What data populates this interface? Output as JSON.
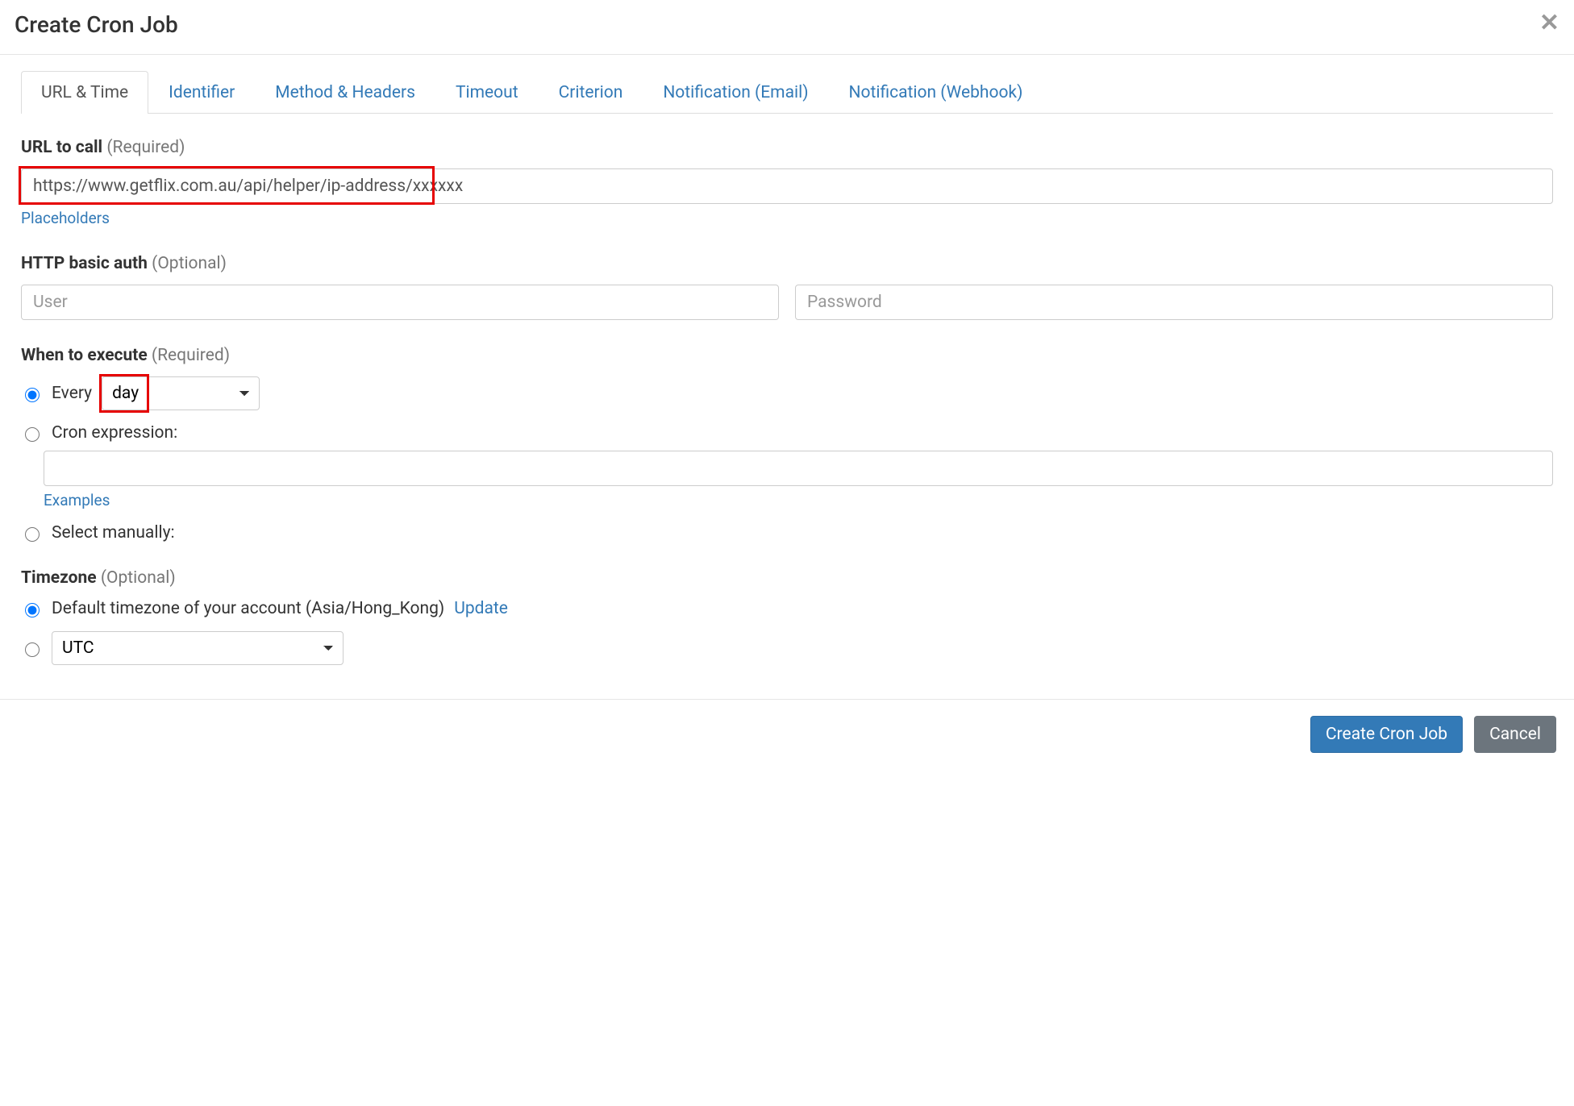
{
  "header": {
    "title": "Create Cron Job"
  },
  "tabs": [
    {
      "label": "URL & Time",
      "active": true
    },
    {
      "label": "Identifier",
      "active": false
    },
    {
      "label": "Method & Headers",
      "active": false
    },
    {
      "label": "Timeout",
      "active": false
    },
    {
      "label": "Criterion",
      "active": false
    },
    {
      "label": "Notification (Email)",
      "active": false
    },
    {
      "label": "Notification (Webhook)",
      "active": false
    }
  ],
  "url_section": {
    "label": "URL to call",
    "req": "(Required)",
    "value": "https://www.getflix.com.au/api/helper/ip-address/xxxxxx",
    "placeholders_link": "Placeholders"
  },
  "auth_section": {
    "label": "HTTP basic auth",
    "req": "(Optional)",
    "user_placeholder": "User",
    "password_placeholder": "Password"
  },
  "execute_section": {
    "label": "When to execute",
    "req": "(Required)",
    "every_label": "Every",
    "every_value": "day",
    "cron_label": "Cron expression:",
    "examples_link": "Examples",
    "select_manually_label": "Select manually:"
  },
  "timezone_section": {
    "label": "Timezone",
    "req": "(Optional)",
    "default_label": "Default timezone of your account (Asia/Hong_Kong)",
    "update_link": "Update",
    "tz_value": "UTC"
  },
  "footer": {
    "primary": "Create Cron Job",
    "cancel": "Cancel"
  }
}
